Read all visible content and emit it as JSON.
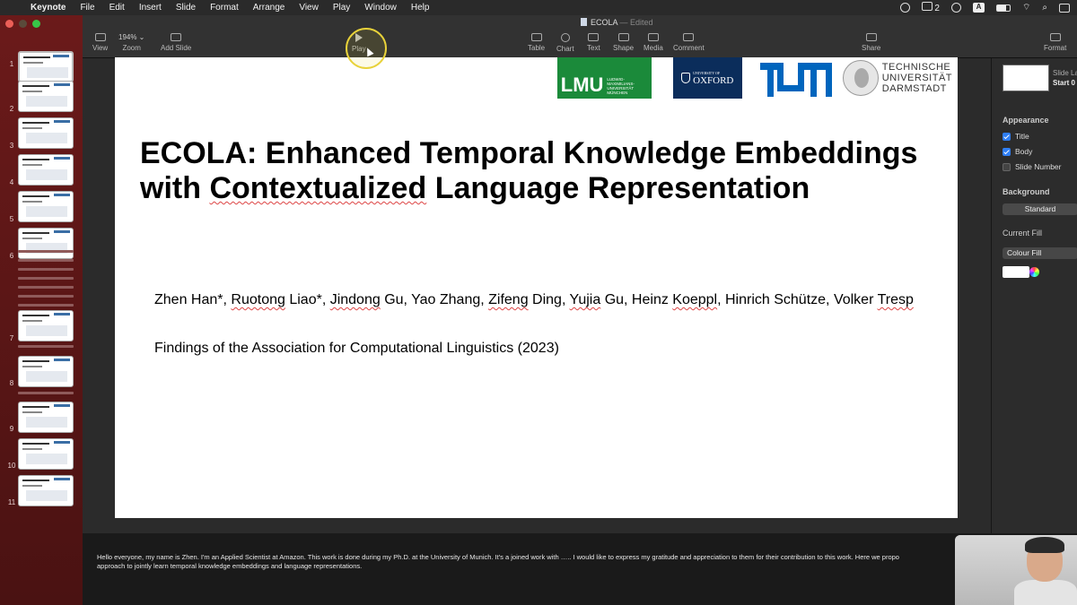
{
  "menubar": {
    "app": "Keynote",
    "items": [
      "File",
      "Edit",
      "Insert",
      "Slide",
      "Format",
      "Arrange",
      "View",
      "Play",
      "Window",
      "Help"
    ],
    "wechat_count": "2",
    "input_source": "A"
  },
  "document": {
    "name": "ECOLA",
    "separator": "—",
    "status": "Edited"
  },
  "toolbar": {
    "view": "View",
    "zoom_value": "194% ⌄",
    "zoom": "Zoom",
    "add_slide": "Add Slide",
    "play": "Play",
    "table": "Table",
    "chart": "Chart",
    "text": "Text",
    "shape": "Shape",
    "media": "Media",
    "comment": "Comment",
    "share": "Share",
    "format": "Format"
  },
  "slides_nav": {
    "numbers": [
      "1",
      "2",
      "3",
      "4",
      "5",
      "6",
      "7",
      "8",
      "9",
      "10",
      "11"
    ]
  },
  "slide": {
    "logos": {
      "lmu": "LMU",
      "lmu_sub": [
        "LUDWIG-",
        "MAXIMILIANS-",
        "UNIVERSITÄT",
        "MÜNCHEN"
      ],
      "oxford_top": "UNIVERSITY OF",
      "oxford": "OXFORD",
      "tud": [
        "TECHNISCHE",
        "UNIVERSITÄT",
        "DARMSTADT"
      ]
    },
    "title_line1": "ECOLA: Enhanced Temporal Knowledge Embeddings",
    "title_line2_pre": "with ",
    "title_line2_err": "Contextualized",
    "title_line2_post": " Language Representation",
    "authors": [
      {
        "t": "Zhen Han*, ",
        "err": false
      },
      {
        "t": "Ruotong",
        "err": true
      },
      {
        "t": " Liao*, ",
        "err": false
      },
      {
        "t": "Jindong",
        "err": true
      },
      {
        "t": " Gu, Yao Zhang, ",
        "err": false
      },
      {
        "t": "Zifeng",
        "err": true
      },
      {
        "t": " Ding, ",
        "err": false
      },
      {
        "t": "Yujia",
        "err": true
      },
      {
        "t": " Gu, Heinz ",
        "err": false
      },
      {
        "t": "Koeppl",
        "err": true
      },
      {
        "t": ", Hinrich Schütze, Volker ",
        "err": false
      },
      {
        "t": "Tresp",
        "err": true
      }
    ],
    "venue": "Findings of the Association for Computational Linguistics (2023)"
  },
  "inspector": {
    "layout_label": "Slide La",
    "layout_value": "Start 0",
    "appearance": "Appearance",
    "title": "Title",
    "body": "Body",
    "slide_number": "Slide Number",
    "background": "Background",
    "background_value": "Standard",
    "current_fill": "Current Fill",
    "fill_value": "Colour Fill"
  },
  "notes": {
    "line1": "Hello everyone, my name is Zhen. I'm an Applied Scientist at Amazon. This work is done during my Ph.D. at the University of Munich. It's a joined work with ….. I would like to express my gratitude and appreciation to them for their contribution to this work. Here we propo",
    "line2": "approach to jointly learn temporal knowledge embeddings and language representations."
  }
}
